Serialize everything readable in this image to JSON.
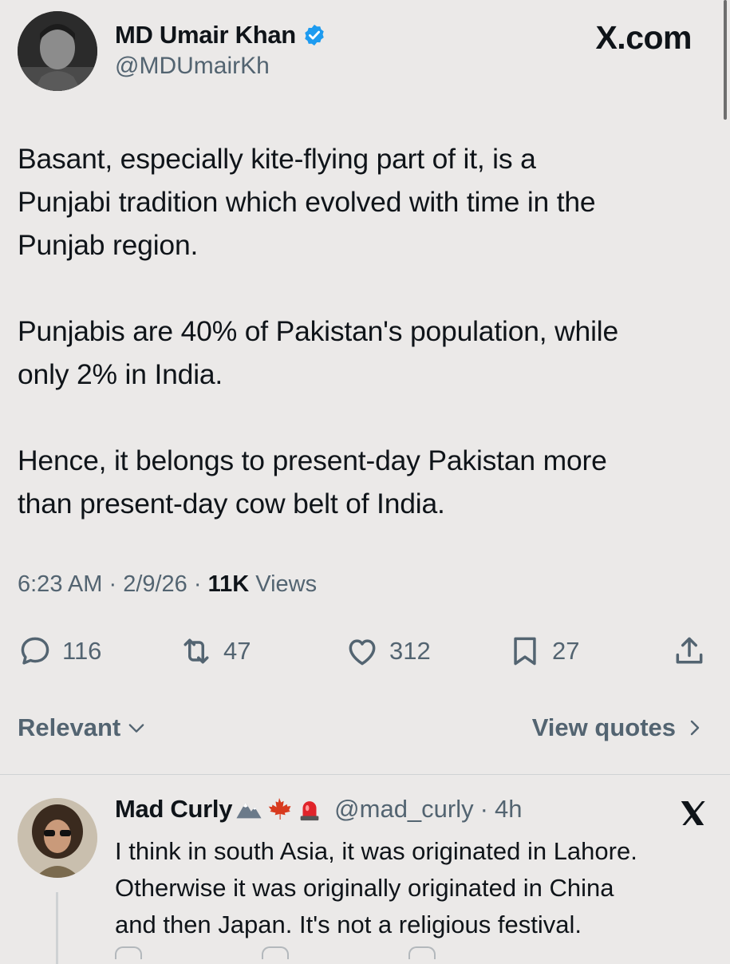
{
  "post": {
    "author_name": "MD Umair Khan",
    "author_handle": "@MDUmairKh",
    "brand": "X.com",
    "text": "Basant, especially kite-flying part of it, is a\nPunjabi tradition which evolved with time in the\nPunjab region.\n\nPunjabis are 40% of Pakistan's population, while\nonly 2% in India.\n\nHence, it belongs to present-day Pakistan more\nthan present-day cow belt of India.",
    "time": "6:23 AM",
    "date": "2/9/26",
    "views_count": "11K",
    "views_label": "Views",
    "verified_color": "#1d9bf0"
  },
  "actions": {
    "replies": "116",
    "reposts": "47",
    "likes": "312",
    "bookmarks": "27"
  },
  "sort": {
    "left_label": "Relevant",
    "right_label": "View quotes"
  },
  "reply": {
    "author_name": "Mad Curly",
    "author_handle": "@mad_curly",
    "age": "4h",
    "text": "I think in south Asia, it was originated in Lahore.\nOtherwise it was originally originated in China\nand then Japan.  It's not a religious festival."
  },
  "icons": [
    "verified-badge-icon",
    "x-logo-icon",
    "reply-icon",
    "repost-icon",
    "like-icon",
    "bookmark-icon",
    "share-icon",
    "chevron-down-icon",
    "chevron-right-icon",
    "mountain-emoji-icon",
    "maple-leaf-emoji-icon",
    "siren-emoji-icon",
    "close-icon"
  ]
}
